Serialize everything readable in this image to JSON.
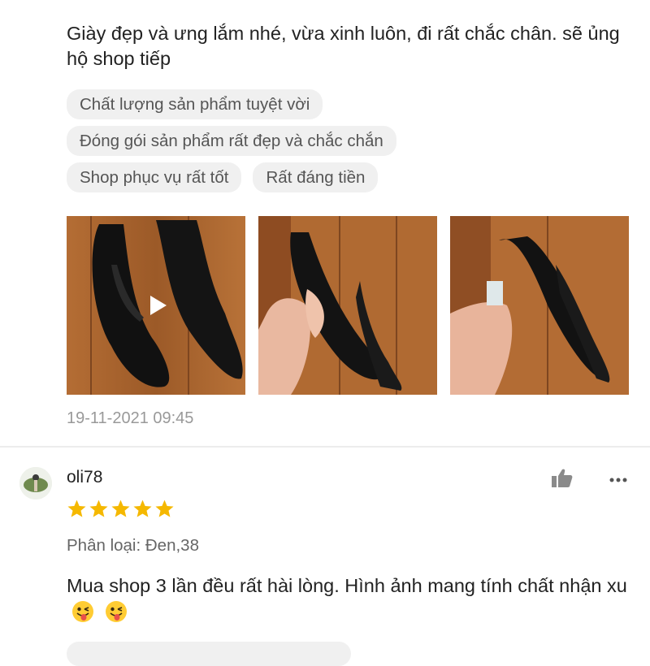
{
  "review1": {
    "comment": "Giày đẹp và ưng lắm nhé, vừa xinh luôn, đi rất chắc chân. sẽ ủng hộ shop tiếp",
    "tags": [
      [
        "Chất lượng sản phẩm tuyệt vời"
      ],
      [
        "Đóng gói sản phẩm rất đẹp và chắc chắn"
      ],
      [
        "Shop phục vụ rất tốt",
        "Rất đáng tiền"
      ]
    ],
    "photos": [
      "video-thumbnail",
      "photo",
      "photo"
    ],
    "timestamp": "19-11-2021 09:45"
  },
  "review2": {
    "username": "oli78",
    "rating": 5,
    "variant": "Phân loại: Đen,38",
    "comment": "Mua shop 3 lần đều rất hài lòng. Hình ảnh mang tính chất nhận xu"
  },
  "icons": {
    "like": "thumbs-up-icon",
    "more": "more-dots-icon",
    "star": "star-icon",
    "play": "play-icon",
    "emoji": "winking-face-with-tongue-icon"
  },
  "colors": {
    "star": "#f5b800",
    "tag_bg": "#f0f0f0",
    "muted_text": "#999999"
  }
}
